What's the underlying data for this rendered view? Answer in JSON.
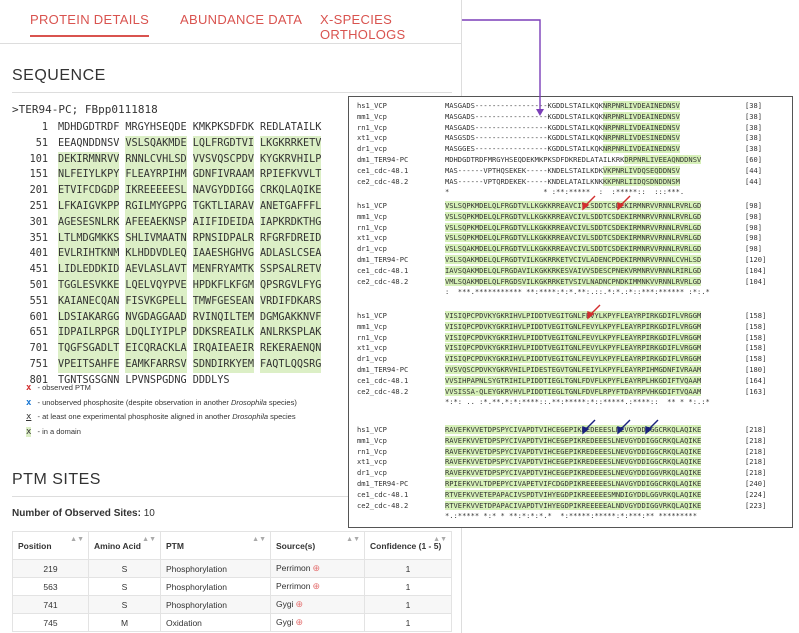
{
  "tabs": [
    {
      "label": "PROTEIN DETAILS",
      "active": true
    },
    {
      "label": "ABUNDANCE DATA",
      "active": false
    },
    {
      "label": "X-SPECIES ORTHOLOGS",
      "active": false
    }
  ],
  "sequence": {
    "title": "SEQUENCE",
    "header": ">TER94-PC; FBpp0111818",
    "rows": [
      {
        "num": "1",
        "chunks": [
          "MDHDGDTRDF",
          "MRGYHSEQDE",
          "KMKPKSDFDK",
          "REDLATAILK"
        ]
      },
      {
        "num": "51",
        "chunks": [
          "EEAQNDDNSV",
          "VSLSQAKMDE",
          "LQLFRGDTVI",
          "LKGKRRKETV"
        ]
      },
      {
        "num": "101",
        "chunks": [
          "DEKIRMNRVV",
          "RNNLCVHLSD",
          "VVSVQSCPDV",
          "KYGKRVHILP"
        ]
      },
      {
        "num": "151",
        "chunks": [
          "NLFEIYLKPY",
          "FLEAYRPIHM",
          "GDNFIVRAAM",
          "RPIEFKVVLT"
        ]
      },
      {
        "num": "201",
        "chunks": [
          "ETVIFCDGDP",
          "IKREEEEESL",
          "NAVGYDDIGG",
          "CRKQLAQIKE"
        ]
      },
      {
        "num": "251",
        "chunks": [
          "LFKAIGVKPP",
          "RGILMYGPPG",
          "TGKTLIARAV",
          "ANETGAFFFL"
        ]
      },
      {
        "num": "301",
        "chunks": [
          "AGESESNLRK",
          "AFEEAEKNSP",
          "AIIFIDEIDA",
          "IAPKRDKTHG"
        ]
      },
      {
        "num": "351",
        "chunks": [
          "LTLMDGMKKS",
          "SHLIVMAATN",
          "RPNSIDPALR",
          "RFGRFDREID"
        ]
      },
      {
        "num": "401",
        "chunks": [
          "EVLRIHTKNM",
          "KLHDDVDLEQ",
          "IAAESHGHVG",
          "ADLASLCSEA"
        ]
      },
      {
        "num": "451",
        "chunks": [
          "LIDLEDDKID",
          "AEVLASLAVT",
          "MENFRYAMTK",
          "SSPSALRETV"
        ]
      },
      {
        "num": "501",
        "chunks": [
          "TGGLESVKKE",
          "LQELVQYPVE",
          "HPDKFLKFGM",
          "QPSRGVLFYG"
        ]
      },
      {
        "num": "551",
        "chunks": [
          "KAIANECQAN",
          "FISVKGPELL",
          "TMWFGESEAN",
          "VRDIFDKARS"
        ]
      },
      {
        "num": "601",
        "chunks": [
          "LDSIAKARGG",
          "NVGDAGGAAD",
          "RVINQILTEM",
          "DGMGAKKNVF"
        ]
      },
      {
        "num": "651",
        "chunks": [
          "IDPAILRPGR",
          "LDQLIYIPLP",
          "DDKSREAILK",
          "ANLRKSPLAK"
        ]
      },
      {
        "num": "701",
        "chunks": [
          "TQGFSGADLT",
          "EICQRACKLA",
          "IRQAIEAEIR",
          "REKERAENQN"
        ]
      },
      {
        "num": "751",
        "chunks": [
          "VPEITSAHFE",
          "EAMKFARRSV",
          "SDNDIRKYEM",
          "FAQTLQQSRG"
        ]
      },
      {
        "num": "801",
        "chunks": [
          "TGNTSGSGNN",
          "LPVNSPGDNG",
          "DDDLYS"
        ]
      }
    ]
  },
  "legend": [
    {
      "key": "x",
      "text": " - observed PTM",
      "style": "red"
    },
    {
      "key": "x",
      "text": " - unobserved phosphosite (despite observation in another ",
      "italic": "Drosophila",
      "after": " species)",
      "style": "blue"
    },
    {
      "key": "x",
      "text": " - at least one experimental phosphosite aligned in another ",
      "italic": "Drosophila",
      "after": " species",
      "style": "under"
    },
    {
      "key": "x",
      "text": " - in a domain",
      "style": "dom"
    }
  ],
  "ptm": {
    "title": "PTM SITES",
    "observed_label": "Number of Observed Sites:",
    "observed_count": "10",
    "columns": [
      "Position",
      "Amino Acid",
      "PTM",
      "Source(s)",
      "Confidence (1 - 5)"
    ],
    "rows": [
      [
        "219",
        "S",
        "Phosphorylation",
        "Perrimon",
        "1"
      ],
      [
        "563",
        "S",
        "Phosphorylation",
        "Perrimon",
        "1"
      ],
      [
        "741",
        "S",
        "Phosphorylation",
        "Gygi",
        "1"
      ],
      [
        "745",
        "M",
        "Oxidation",
        "Gygi",
        "1"
      ]
    ]
  },
  "alignment": {
    "blocks": [
      {
        "rows": [
          {
            "name": "hs1_VCP",
            "seq": "MASGADS-----------------KGDDLSTAILKQKNRPNRLIVDEAINEDNSV",
            "num": "[38]"
          },
          {
            "name": "mm1_Vcp",
            "seq": "MASGADS-----------------KGDDLSTAILKQKNRPNRLIVDEAINEDNSV",
            "num": "[38]"
          },
          {
            "name": "rn1_Vcp",
            "seq": "MASGADS-----------------KGDDLSTAILKQKNRPNRLIVDEAINEDNSV",
            "num": "[38]"
          },
          {
            "name": "xt1_vcp",
            "seq": "MASGSDS-----------------KGDDLSTAILKQKNRPNRLIVDESINEDNSV",
            "num": "[38]"
          },
          {
            "name": "dr1_vcp",
            "seq": "MASGGES-----------------KGDDLSTAILKQKNRPNRLIVDEAINEDNSV",
            "num": "[38]"
          },
          {
            "name": "dm1_TER94-PC",
            "seq": "MDHDGDTRDFMRGYHSEQDEKMKPKSDFDKREDLATAILKRKDRPNRLIVEEAQNDDNSV",
            "num": "[60]"
          },
          {
            "name": "ce1_cdc-48.1",
            "seq": "MAS------VPTHQSEKEK-----KNDELSTAILKDKVKPNRLIVDQSEQDDNSV",
            "num": "[44]"
          },
          {
            "name": "ce2_cdc-48.2",
            "seq": "MAS------VPTQRDEKEK-----KNDELATAILKNKKKPNRLIIDQSDNDDNSM",
            "num": "[44]"
          }
        ],
        "cons": "*                      * :**:*****  :  :*****::  :::***."
      },
      {
        "rows": [
          {
            "name": "hs1_VCP",
            "seq": "VSLSQPKMDELQLFRGDTVLLKGKKRREAVCIVLSDDTCSDEKIRMNRVVRNNLRVRLGD",
            "num": "[98]"
          },
          {
            "name": "mm1_Vcp",
            "seq": "VSLSQPKMDELQLFRGDTVLLKGKKRREAVCIVLSDDTCSDEKIRMNRVVRNNLRVRLGD",
            "num": "[98]"
          },
          {
            "name": "rn1_Vcp",
            "seq": "VSLSQPKMDELQLFRGDTVLLKGKKRREAVCIVLSDDTCSDEKIRMNRVVRNNLRVRLGD",
            "num": "[98]"
          },
          {
            "name": "xt1_vcp",
            "seq": "VSLSQPKMDELQLFRGDTVLLKGKKRREAVCIVLSDDTCSDEKIRMNRVVRNNLRVRLGD",
            "num": "[98]"
          },
          {
            "name": "dr1_vcp",
            "seq": "VSLSQAKMDELQLFRGDTVLLKGKKRREAVCIVLSDDTCSDEKIRMNRVVRNNLRVRLGD",
            "num": "[98]"
          },
          {
            "name": "dm1_TER94-PC",
            "seq": "VSLSQAKMDELQLFRGDTVILKGKRRKETVCIVLADENCPDEKIRMNRVVRNNLCVHLSD",
            "num": "[120]"
          },
          {
            "name": "ce1_cdc-48.1",
            "seq": "IAVSQAKMDELQLFRGDAVILKGKKRKESVAIVVSDESCPNEKVRMNRVVRNNLRIRLGD",
            "num": "[104]"
          },
          {
            "name": "ce2_cdc-48.2",
            "seq": "VMLSQAKMDELQLFRGDSVILKGKRRKETVSIVLNADNCPNDKIMMNKVVRNNLRVRLGD",
            "num": "[104]"
          }
        ],
        "cons": ":  ***.*********** **:****:*:*.**:.::.*:*.:*::***:****** :*:.*"
      },
      {
        "rows": [
          {
            "name": "hs1_VCP",
            "seq": "VISIQPCPDVKYGKRIHVLPIDDTVEGITGNLFEVYLKPYFLEAYRPIRKGDIFLVRGGM",
            "num": "[158]"
          },
          {
            "name": "mm1_Vcp",
            "seq": "VISIQPCPDVKYGKRIHVLPIDDTVEGITGNLFEVYLKPYFLEAYRPIRKGDIFLVRGGM",
            "num": "[158]"
          },
          {
            "name": "rn1_Vcp",
            "seq": "VISIQPCPDVKYGKRIHVLPIDDTVEGITGNLFEVYLKPYFLEAYRPIRKGDIFLVRGGM",
            "num": "[158]"
          },
          {
            "name": "xt1_vcp",
            "seq": "VISIQPCPDVKYGKRIHVLPIDDTVEGITGNLFEVYLKPYFLEAYRPIRKGDIFLVRGGM",
            "num": "[158]"
          },
          {
            "name": "dr1_vcp",
            "seq": "VISIQPCPDVKYGKRIHVLPIDDTVEGITGNLFEVYLKPYFLEAYRPIRKGDIFLVRGGM",
            "num": "[158]"
          },
          {
            "name": "dm1_TER94-PC",
            "seq": "VVSVQSCPDVKYGKRVHILPIDESTEGVTGNLFEIYLKPYFLEAYRPIHMGDNFIVRAAM",
            "num": "[180]"
          },
          {
            "name": "ce1_cdc-48.1",
            "seq": "VVSIHPAPNLSYGTRIHILPIDDTIEGLTGNLFDVFLKPYFLEAYRPLHKGDIFTVQAAM",
            "num": "[164]"
          },
          {
            "name": "ce2_cdc-48.2",
            "seq": "VVSISSA-QLEYGKRVHVLPIDDTIEGLTGNLFDVFLRPYFTDAYRPVHKGDIFTVQAAM",
            "num": "[163]"
          }
        ],
        "cons": "*:*: .. :*.**.*:*:****::.**:*****:*::*****.:****::  ** * *:.:*"
      },
      {
        "rows": [
          {
            "name": "hs1_VCP",
            "seq": "RAVEFKVVETDPSPYCIVAPDTVIHCEGEPIKREDEEESLNEVGYDDIGGCRKQLAQIKE",
            "num": "[218]"
          },
          {
            "name": "mm1_Vcp",
            "seq": "RAVEFKVVETDPSPYCIVAPDTVIHCEGEPIKREDEEESLNEVGYDDIGGCRKQLAQIKE",
            "num": "[218]"
          },
          {
            "name": "rn1_Vcp",
            "seq": "RAVEFKVVETDPSPYCIVAPDTVIHCEGEPIKREDEEESLNEVGYDDIGGCRKQLAQIKE",
            "num": "[218]"
          },
          {
            "name": "xt1_vcp",
            "seq": "RAVEFKVVETDPSPYCIVAPDTVIHCEGEPIKREDEEESLNEVGYDDIGGCRKQLAQIKE",
            "num": "[218]"
          },
          {
            "name": "dr1_vcp",
            "seq": "RAVEFKVVETDPSPYCIVAPDTVIHCEGEPIKREDEEESLNEVGYDDIGGVRKQLAQIKE",
            "num": "[218]"
          },
          {
            "name": "dm1_TER94-PC",
            "seq": "RPIEFKVVLTDPEPYCIVAPETVIFCDGDPIKREEEEESLNAVGYDDIGGCRKQLAQIKE",
            "num": "[240]"
          },
          {
            "name": "ce1_cdc-48.1",
            "seq": "RTVEFKVVETEPAPACIVSPDTVIHYEGDPIKREEEEESMNDIGYDDLGGVRKQLAQIKE",
            "num": "[224]"
          },
          {
            "name": "ce2_cdc-48.2",
            "seq": "RTVEFKVVETDPAPACIVAPDTVIHYEGDPIKREEEEEALNDVGYDDIGGVRKQLAQIKE",
            "num": "[223]"
          }
        ],
        "cons": "*.:***** *:* * **:*:*:*.*  *:*****:*****:*:***:** *********"
      }
    ]
  }
}
